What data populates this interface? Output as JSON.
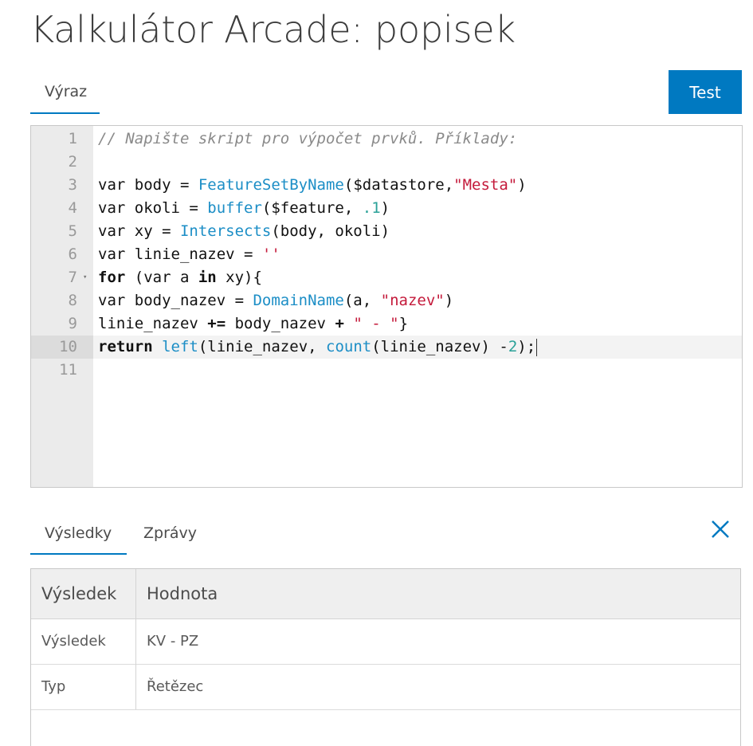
{
  "page": {
    "title": "Kalkulátor Arcade: popisek"
  },
  "editor_panel": {
    "tab_label": "Výraz",
    "test_button_label": "Test"
  },
  "editor": {
    "lines": [
      {
        "number": "1",
        "tokens": [
          {
            "t": "// Napište skript pro výpočet prvků. Příklady:",
            "c": "#8a8a8a",
            "i": true
          }
        ]
      },
      {
        "number": "2",
        "tokens": []
      },
      {
        "number": "3",
        "tokens": [
          {
            "t": "var body = ",
            "c": "#111111"
          },
          {
            "t": "FeatureSetByName",
            "c": "#1c8ec6"
          },
          {
            "t": "($datastore,",
            "c": "#111111"
          },
          {
            "t": "\"Mesta\"",
            "c": "#c41a3b"
          },
          {
            "t": ")",
            "c": "#111111"
          }
        ]
      },
      {
        "number": "4",
        "tokens": [
          {
            "t": "var okoli = ",
            "c": "#111111"
          },
          {
            "t": "buffer",
            "c": "#1c8ec6"
          },
          {
            "t": "($feature, ",
            "c": "#111111"
          },
          {
            "t": ".1",
            "c": "#2aa198"
          },
          {
            "t": ")",
            "c": "#111111"
          }
        ]
      },
      {
        "number": "5",
        "tokens": [
          {
            "t": "var xy = ",
            "c": "#111111"
          },
          {
            "t": "Intersects",
            "c": "#1c8ec6"
          },
          {
            "t": "(body, okoli)",
            "c": "#111111"
          }
        ]
      },
      {
        "number": "6",
        "tokens": [
          {
            "t": "var linie_nazev = ",
            "c": "#111111"
          },
          {
            "t": "''",
            "c": "#c41a3b"
          }
        ]
      },
      {
        "number": "7",
        "fold": true,
        "tokens": [
          {
            "t": "for",
            "c": "#111111",
            "b": true
          },
          {
            "t": " (var a ",
            "c": "#111111"
          },
          {
            "t": "in",
            "c": "#111111",
            "b": true
          },
          {
            "t": " xy){",
            "c": "#111111"
          }
        ]
      },
      {
        "number": "8",
        "tokens": [
          {
            "t": "var body_nazev = ",
            "c": "#111111"
          },
          {
            "t": "DomainName",
            "c": "#1c8ec6"
          },
          {
            "t": "(a, ",
            "c": "#111111"
          },
          {
            "t": "\"nazev\"",
            "c": "#c41a3b"
          },
          {
            "t": ")",
            "c": "#111111"
          }
        ]
      },
      {
        "number": "9",
        "tokens": [
          {
            "t": "linie_nazev ",
            "c": "#111111"
          },
          {
            "t": "+=",
            "c": "#111111",
            "b": true
          },
          {
            "t": " body_nazev ",
            "c": "#111111"
          },
          {
            "t": "+",
            "c": "#111111",
            "b": true
          },
          {
            "t": " ",
            "c": "#111111"
          },
          {
            "t": "\" - \"",
            "c": "#c41a3b"
          },
          {
            "t": "}",
            "c": "#111111"
          }
        ]
      },
      {
        "number": "10",
        "active": true,
        "cursor": true,
        "tokens": [
          {
            "t": "return",
            "c": "#111111",
            "b": true
          },
          {
            "t": " ",
            "c": "#111111"
          },
          {
            "t": "left",
            "c": "#1c8ec6"
          },
          {
            "t": "(linie_nazev, ",
            "c": "#111111"
          },
          {
            "t": "count",
            "c": "#1c8ec6"
          },
          {
            "t": "(linie_nazev) -",
            "c": "#111111"
          },
          {
            "t": "2",
            "c": "#2aa198"
          },
          {
            "t": ");",
            "c": "#111111"
          }
        ]
      },
      {
        "number": "11",
        "tokens": []
      }
    ]
  },
  "results_panel": {
    "tabs": [
      {
        "label": "Výsledky",
        "active": true
      },
      {
        "label": "Zprávy",
        "active": false
      }
    ],
    "table": {
      "headers": [
        "Výsledek",
        "Hodnota"
      ],
      "rows": [
        [
          "Výsledek",
          "KV - PZ"
        ],
        [
          "Typ",
          "Řetězec"
        ]
      ]
    }
  },
  "colors": {
    "accent": "#0079c1"
  },
  "icons": {
    "close": "close-icon",
    "fold": "fold-arrow-icon"
  }
}
